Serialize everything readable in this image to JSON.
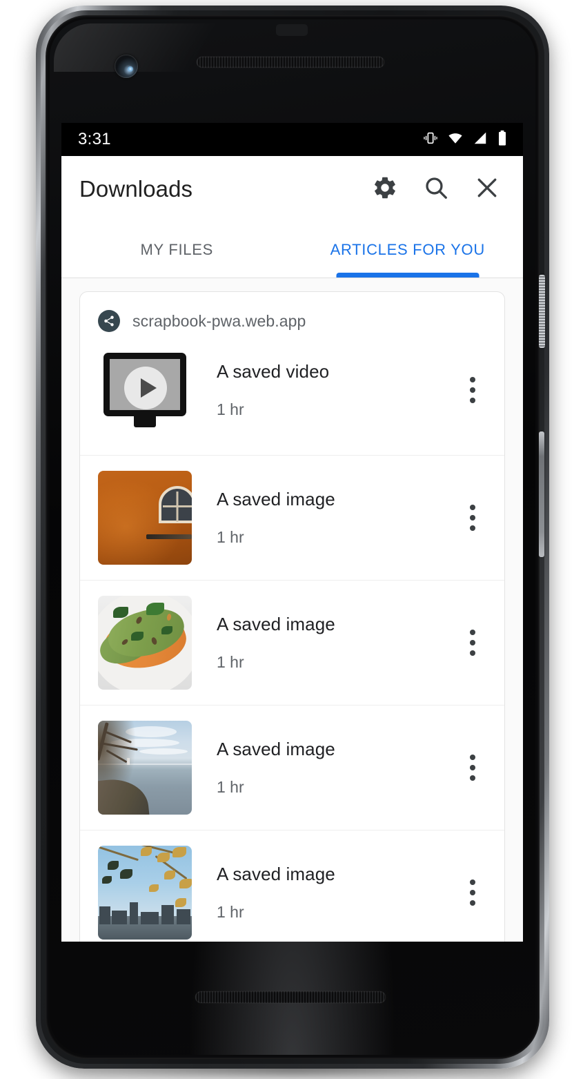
{
  "status_bar": {
    "time": "3:31",
    "icons": [
      "vibrate-icon",
      "wifi-icon",
      "signal-icon",
      "battery-icon"
    ]
  },
  "app_bar": {
    "title": "Downloads",
    "actions": [
      {
        "name": "settings",
        "icon": "gear-icon"
      },
      {
        "name": "search",
        "icon": "search-icon"
      },
      {
        "name": "close",
        "icon": "close-icon"
      }
    ]
  },
  "tabs": [
    {
      "label": "MY FILES",
      "active": false
    },
    {
      "label": "ARTICLES FOR YOU",
      "active": true
    }
  ],
  "colors": {
    "accent": "#1a73e8",
    "title_text": "#202124",
    "secondary_text": "#5f6368",
    "surface": "#ffffff",
    "background": "#fafafa",
    "badge": "#37474f"
  },
  "card": {
    "site_icon": "share-icon",
    "site_name": "scrapbook-pwa.web.app",
    "rows": [
      {
        "title": "A saved video",
        "subtitle": "1 hr",
        "thumb": "video-placeholder-icon",
        "menu": "overflow-menu-icon"
      },
      {
        "title": "A saved image",
        "subtitle": "1 hr",
        "thumb": "photo-orange-wall",
        "menu": "overflow-menu-icon"
      },
      {
        "title": "A saved image",
        "subtitle": "1 hr",
        "thumb": "photo-avocado-toast",
        "menu": "overflow-menu-icon"
      },
      {
        "title": "A saved image",
        "subtitle": "1 hr",
        "thumb": "photo-lake-shore",
        "menu": "overflow-menu-icon"
      },
      {
        "title": "A saved image",
        "subtitle": "1 hr",
        "thumb": "photo-autumn-city",
        "menu": "overflow-menu-icon"
      }
    ]
  }
}
